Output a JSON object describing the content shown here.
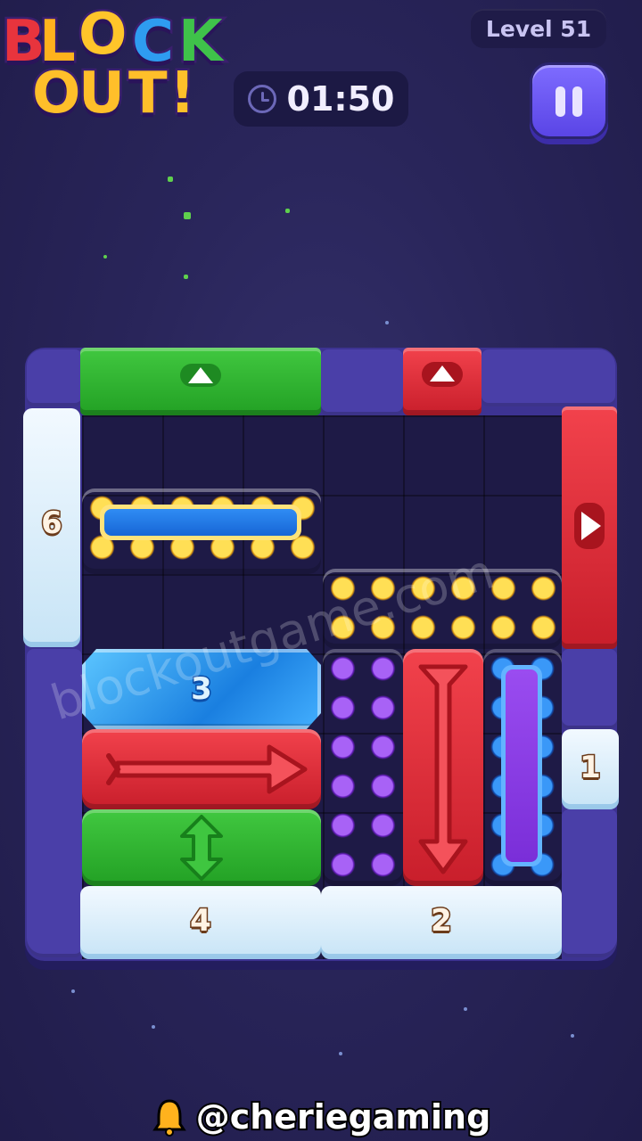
{
  "logo": {
    "text": "BLOCK OUT!",
    "line1": [
      "B",
      "L",
      "O",
      "C",
      "K"
    ],
    "line2": [
      "O",
      "U",
      "T",
      "!"
    ]
  },
  "header": {
    "level": "Level 51",
    "timer": "01:50"
  },
  "board": {
    "counters": {
      "left": "6",
      "right": "1",
      "bottom_left": "4",
      "bottom_right": "2",
      "ice_block": "3"
    }
  },
  "watermark": "blockoutgame.com",
  "footer": {
    "handle": "@cheriegaming"
  },
  "colors": {
    "frame": "#4a3fa8",
    "green": "#2fb52f",
    "red": "#e0323d",
    "yellow": "#ffc72c",
    "purple": "#8a3ee6",
    "blue": "#2279e8"
  }
}
